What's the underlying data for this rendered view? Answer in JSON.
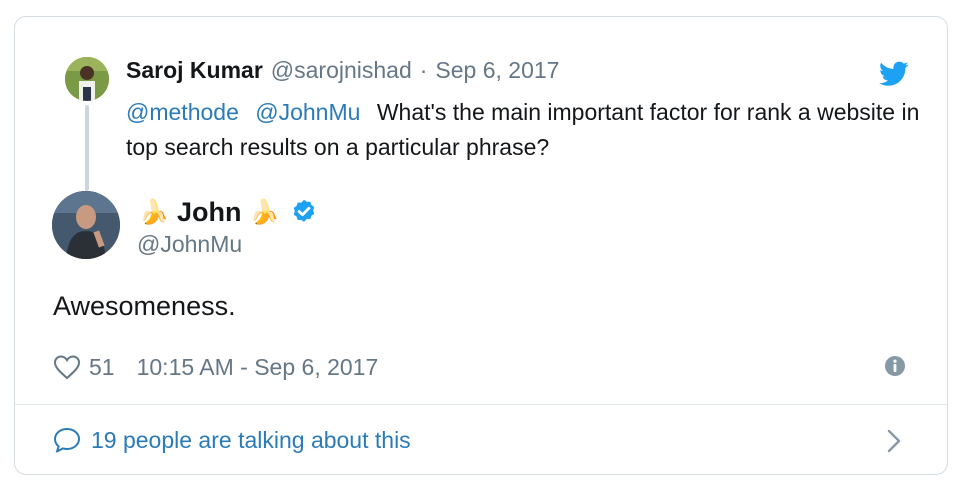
{
  "parent_tweet": {
    "author_name": "Saroj Kumar",
    "author_handle": "@sarojnishad",
    "separator": "·",
    "date": "Sep 6, 2017",
    "mentions": [
      "@methode",
      "@JohnMu"
    ],
    "text": "What's the main important factor for rank a website in top search results on a particular phrase?"
  },
  "tweet": {
    "author_prefix_emoji": "🍌",
    "author_name": "John",
    "author_suffix_emoji": "🍌",
    "author_handle": "@JohnMu",
    "verified": true,
    "text": "Awesomeness.",
    "like_count": "51",
    "timestamp": "10:15 AM - Sep 6, 2017"
  },
  "footer": {
    "conversation_label": "19 people are talking about this"
  },
  "icons": {
    "brand": "twitter-bird-icon",
    "like": "heart-icon",
    "info": "info-icon",
    "reply": "comment-icon",
    "open": "chevron-right-icon",
    "verified": "verified-badge-icon"
  },
  "colors": {
    "link": "#2b7bb9",
    "twitter_blue": "#1da1f2",
    "secondary_text": "#657786",
    "primary_text": "#14171a",
    "border": "#d6dde3"
  }
}
